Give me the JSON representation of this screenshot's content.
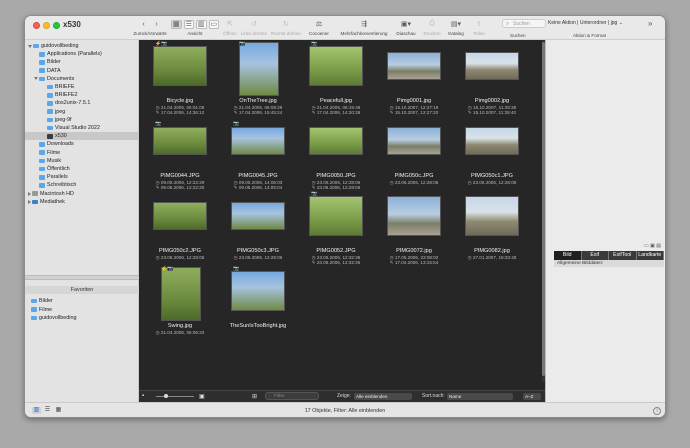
{
  "window": {
    "title": "x530"
  },
  "toolbar": {
    "groups": [
      {
        "label": "Zurück/Vorwärts"
      },
      {
        "label": "Ansicht"
      },
      {
        "label": "Öffnen"
      },
      {
        "label": "Links drehen"
      },
      {
        "label": "Rechts drehen"
      },
      {
        "label": "Cocoener"
      },
      {
        "label": "Mehrfachkonvertierung"
      },
      {
        "label": "Diaschau"
      },
      {
        "label": "Drucken"
      },
      {
        "label": "Katalog"
      },
      {
        "label": "Teilen"
      },
      {
        "label": "Suchen"
      },
      {
        "label": "Aktion & Format"
      }
    ],
    "search_placeholder": "Suchen",
    "action_value": "Keine Aktion | Unterordner | jpg"
  },
  "sidebar": {
    "tree": [
      {
        "label": "guidovollbeding"
      },
      {
        "label": "Applications (Parallels)"
      },
      {
        "label": "Bilder"
      },
      {
        "label": "DATA"
      },
      {
        "label": "Documents"
      },
      {
        "label": "BRIEFE"
      },
      {
        "label": "BRIEFE2"
      },
      {
        "label": "dos2unix-7.5.1"
      },
      {
        "label": "jpeg"
      },
      {
        "label": "jpeg-9f"
      },
      {
        "label": "Visual Studio 2022"
      },
      {
        "label": "x530"
      },
      {
        "label": "Downloads"
      },
      {
        "label": "Filme"
      },
      {
        "label": "Musik"
      },
      {
        "label": "Öffentlich"
      },
      {
        "label": "Parallels"
      },
      {
        "label": "Schreibtisch"
      },
      {
        "label": "Macintosh HD"
      },
      {
        "label": "Mediathek"
      }
    ],
    "favorites_title": "Favoriten",
    "favorites": [
      {
        "label": "Bilder"
      },
      {
        "label": "Filme"
      },
      {
        "label": "guidovollbeding"
      }
    ]
  },
  "grid": {
    "items": [
      {
        "name": "Bicycle.jpg",
        "d1": "21.04.2005, 06:01:09",
        "d2": "17.04.2006, 14:36:12",
        "shape": "square",
        "icon": "flash+camera"
      },
      {
        "name": "OnTheTree.jpg",
        "d1": "21.04.2005, 06:09:29",
        "d2": "17.04.2006, 15:45:24",
        "shape": "portrait",
        "icon": "camera"
      },
      {
        "name": "Peacefull.jpg",
        "d1": "21.04.2005, 06:19:49",
        "d2": "17.04.2006, 14:20:36",
        "shape": "square",
        "icon": "camera"
      },
      {
        "name": "Pimg0001.jpg",
        "d1": "15.10.2007, 12:27:19",
        "d2": "15.10.2007, 12:27:20",
        "shape": "landscape",
        "icon": ""
      },
      {
        "name": "Pimg0002.jpg",
        "d1": "15.10.2007, 11:39:38",
        "d2": "15.10.2007, 11:39:40",
        "shape": "landscape",
        "icon": ""
      },
      {
        "name": "PIMG0044.JPG",
        "d1": "09.05.2006, 12:22:29",
        "d2": "09.05.2006, 12:22:30",
        "shape": "landscape",
        "icon": "camera"
      },
      {
        "name": "PIMG0045.JPG",
        "d1": "09.05.2006, 14:05:03",
        "d2": "09.05.2006, 14:05:04",
        "shape": "landscape",
        "icon": "camera"
      },
      {
        "name": "PIMG0050.JPG",
        "d1": "23.06.2006, 12:28:06",
        "d2": "23.06.2006, 12:28:06",
        "shape": "landscape",
        "icon": ""
      },
      {
        "name": "PIMG050c.JPG",
        "d1": "23.06.2006, 12:28:06",
        "d2": "",
        "shape": "landscape",
        "icon": ""
      },
      {
        "name": "PIMG050c1.JPG",
        "d1": "23.06.2006, 12:28:06",
        "d2": "",
        "shape": "landscape",
        "icon": ""
      },
      {
        "name": "PIMG050c2.JPG",
        "d1": "23.06.2006, 12:28:06",
        "d2": "",
        "shape": "landscape",
        "icon": ""
      },
      {
        "name": "PIMG050c3.JPG",
        "d1": "23.06.2006, 12:28:06",
        "d2": "",
        "shape": "landscape",
        "icon": ""
      },
      {
        "name": "PIMG0052.JPG",
        "d1": "23.06.2006, 12:32:36",
        "d2": "23.06.2006, 12:32:36",
        "shape": "square",
        "icon": "camera"
      },
      {
        "name": "PIMG0072.jpg",
        "d1": "17.05.2006, 23:08:02",
        "d2": "17.04.2006, 13:15:54",
        "shape": "square",
        "icon": ""
      },
      {
        "name": "PIMG0082.jpg",
        "d1": "27.01.2007, 19:33:48",
        "d2": "",
        "shape": "square",
        "icon": ""
      },
      {
        "name": "Swing.jpg",
        "d1": "21.04.2005, 06:06:23",
        "d2": "",
        "shape": "portrait",
        "icon": "flash+camera"
      },
      {
        "name": "TheSunIsTooBright.jpg",
        "d1": "",
        "d2": "",
        "shape": "square",
        "icon": "camera"
      }
    ]
  },
  "gridbar": {
    "show_label": "Zeige:",
    "show_value": "Alle einblenden",
    "sort_label": "Sort.nach:",
    "sort_value": "Name",
    "order_value": "A–Z",
    "filter_placeholder": "Filter"
  },
  "rpanel": {
    "tabs": [
      {
        "label": "Bild"
      },
      {
        "label": "Exif"
      },
      {
        "label": "ExifTool"
      },
      {
        "label": "Landkarte"
      }
    ],
    "sub_label": "Allgemeine Bilddaten:"
  },
  "status": {
    "text": "17 Objekte, Filter: Alle einblenden"
  }
}
